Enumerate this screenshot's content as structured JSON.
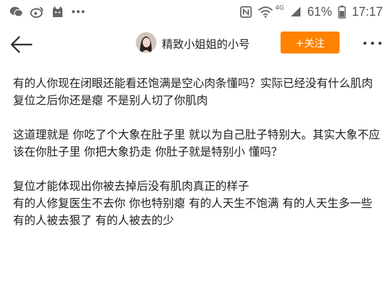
{
  "status_bar": {
    "battery_percent": "61%",
    "time": "17:17",
    "network_label": "4G",
    "icons": [
      "wechat-icon",
      "weibo-icon",
      "cat-icon",
      "more-dots-icon",
      "nfc-icon",
      "wifi-icon",
      "signal-icon"
    ]
  },
  "nav": {
    "title": "精致小姐姐的小号",
    "follow_label": "+关注"
  },
  "post": {
    "lines": [
      "有的人你现在闭眼还能看还饱满是空心肉条懂吗？实际已经没有什么肌肉",
      "复位之后你还是瘪 不是别人切了你肌肉",
      "",
      "这道理就是 你吃了个大象在肚子里 就以为自己肚子特别大。其实大象不应该在你肚子里 你把大象扔走 你肚子就是特别小 懂吗？",
      "",
      "复位才能体现出你被去掉后没有肌肉真正的样子",
      "有的人修复医生不去你 你也特别瘪 有的人天生不饱满 有的人天生多一些 有的人被去狠了 有的人被去的少"
    ]
  },
  "colors": {
    "accent": "#ff8200",
    "text": "#1f1f1f",
    "status": "#555555"
  }
}
